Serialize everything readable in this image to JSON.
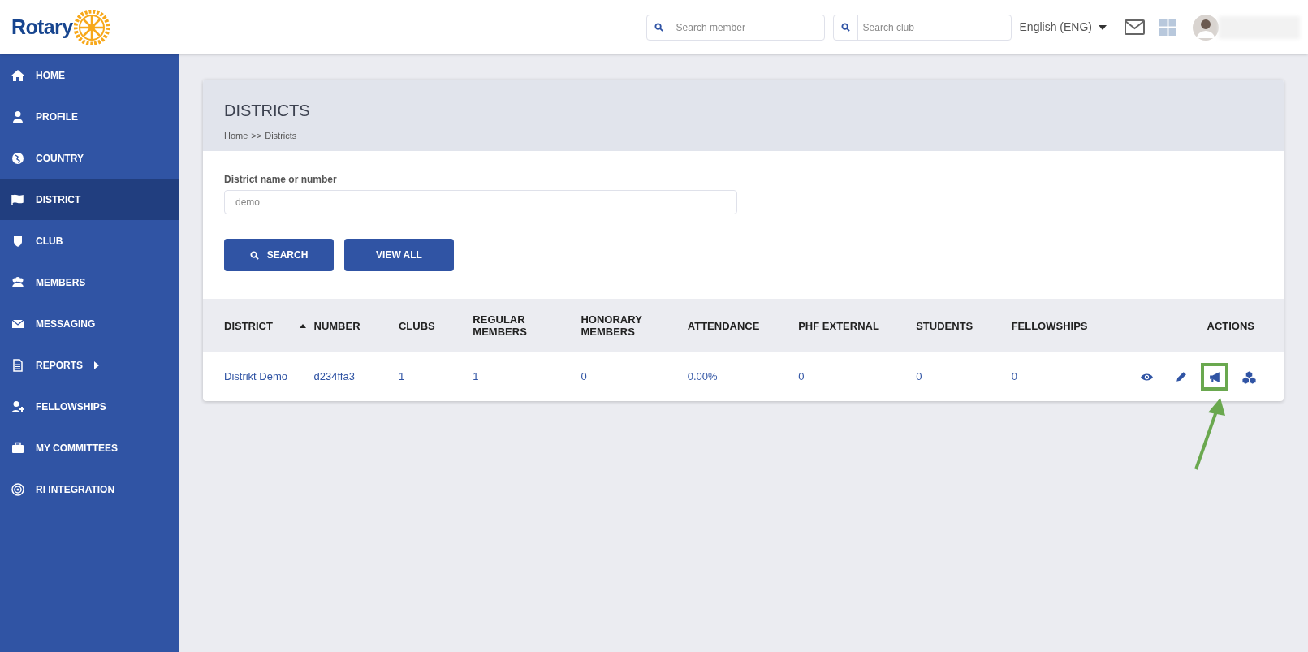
{
  "header": {
    "logo": "Rotary",
    "search_member": {
      "placeholder": "Search member"
    },
    "search_club": {
      "placeholder": "Search club"
    },
    "language": "English (ENG)"
  },
  "sidebar": {
    "items": [
      {
        "label": "HOME",
        "selected": false,
        "submenu": false
      },
      {
        "label": "PROFILE",
        "selected": false,
        "submenu": false
      },
      {
        "label": "COUNTRY",
        "selected": false,
        "submenu": false
      },
      {
        "label": "DISTRICT",
        "selected": true,
        "submenu": false
      },
      {
        "label": "CLUB",
        "selected": false,
        "submenu": false
      },
      {
        "label": "MEMBERS",
        "selected": false,
        "submenu": false
      },
      {
        "label": "MESSAGING",
        "selected": false,
        "submenu": false
      },
      {
        "label": "REPORTS",
        "selected": false,
        "submenu": true
      },
      {
        "label": "FELLOWSHIPS",
        "selected": false,
        "submenu": false
      },
      {
        "label": "MY COMMITTEES",
        "selected": false,
        "submenu": false
      },
      {
        "label": "RI INTEGRATION",
        "selected": false,
        "submenu": false
      }
    ]
  },
  "page": {
    "title": "DISTRICTS",
    "breadcrumb": [
      "Home",
      ">>",
      "Districts"
    ]
  },
  "filter": {
    "label": "District name or number",
    "value": "demo",
    "buttons": [
      {
        "label": "SEARCH",
        "icon": true
      },
      {
        "label": "VIEW ALL",
        "icon": false
      }
    ]
  },
  "table": {
    "columns": [
      {
        "label": "DISTRICT",
        "sorted": true
      },
      {
        "label": "NUMBER",
        "sorted": false
      },
      {
        "label": "CLUBS",
        "sorted": false
      },
      {
        "label": "REGULAR MEMBERS",
        "sorted": false
      },
      {
        "label": "HONORARY MEMBERS",
        "sorted": false
      },
      {
        "label": "ATTENDANCE",
        "sorted": false
      },
      {
        "label": "PHF EXTERNAL",
        "sorted": false
      },
      {
        "label": "STUDENTS",
        "sorted": false
      },
      {
        "label": "FELLOWSHIPS",
        "sorted": false
      },
      {
        "label": "ACTIONS",
        "sorted": false
      }
    ],
    "rows": [
      {
        "cells": [
          "Distrikt Demo",
          "d234ffa3",
          "1",
          "1",
          "0",
          "0.00%",
          "0",
          "0",
          "0"
        ],
        "actions": [
          {
            "highlighted": false
          },
          {
            "highlighted": false
          },
          {
            "highlighted": true
          },
          {
            "highlighted": false
          }
        ]
      }
    ]
  }
}
